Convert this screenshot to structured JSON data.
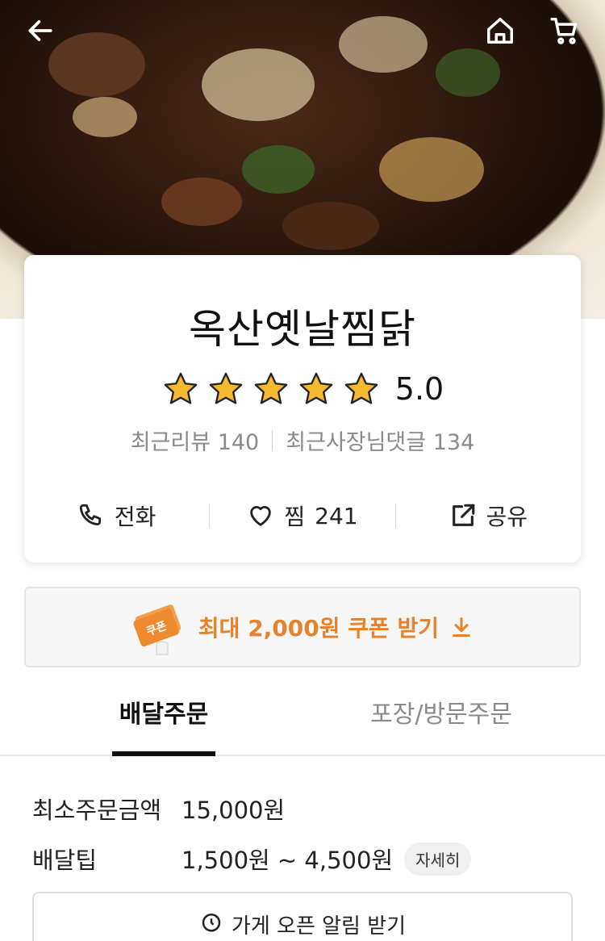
{
  "header": {
    "back_icon": "back-arrow-icon",
    "home_icon": "home-icon",
    "cart_icon": "cart-icon"
  },
  "store": {
    "name": "옥산옛날찜닭",
    "rating": "5.0",
    "star_count": 5,
    "recent_reviews_label": "최근리뷰",
    "recent_reviews_count": "140",
    "owner_replies_label": "최근사장님댓글",
    "owner_replies_count": "134"
  },
  "actions": {
    "call_label": "전화",
    "like_label": "찜",
    "like_count": "241",
    "share_label": "공유"
  },
  "coupon": {
    "badge_text": "쿠폰",
    "label": "최대 2,000원 쿠폰 받기",
    "color": "#e8822a"
  },
  "tabs": [
    {
      "label": "배달주문",
      "active": true
    },
    {
      "label": "포장/방문주문",
      "active": false
    }
  ],
  "info": {
    "min_order_label": "최소주문금액",
    "min_order_value": "15,000원",
    "delivery_tip_label": "배달팁",
    "delivery_tip_value": "1,500원 ~ 4,500원",
    "detail_button": "자세히"
  },
  "alarm": {
    "label": "가게 오픈 알림 받기"
  }
}
